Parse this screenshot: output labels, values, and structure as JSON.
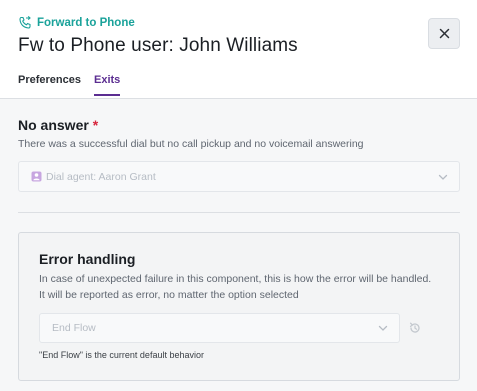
{
  "header": {
    "breadcrumb_icon": "phone-forward-icon",
    "breadcrumb_label": "Forward to Phone",
    "title": "Fw to Phone user: John Williams",
    "close_icon": "close-icon"
  },
  "tabs": [
    {
      "label": "Preferences",
      "active": false
    },
    {
      "label": "Exits",
      "active": true
    }
  ],
  "no_answer": {
    "title": "No answer",
    "required_mark": "*",
    "description": "There was a successful dial but no call pickup and no voicemail answering",
    "select_icon": "agent-badge-icon",
    "select_value": "Dial agent: Aaron Grant",
    "chevron_icon": "chevron-down-icon"
  },
  "error_handling": {
    "title": "Error handling",
    "description": "In case of unexpected failure in this component, this is how the error will be handled. It will be reported as error, no matter the option selected",
    "select_value": "End Flow",
    "chevron_icon": "chevron-down-icon",
    "reset_icon": "reset-icon",
    "note": "\"End Flow\" is the current default behavior"
  },
  "colors": {
    "accent_teal": "#1aa29a",
    "accent_purple": "#5b2d91",
    "required_red": "#d7263d",
    "agent_badge": "#c7a6e0"
  }
}
